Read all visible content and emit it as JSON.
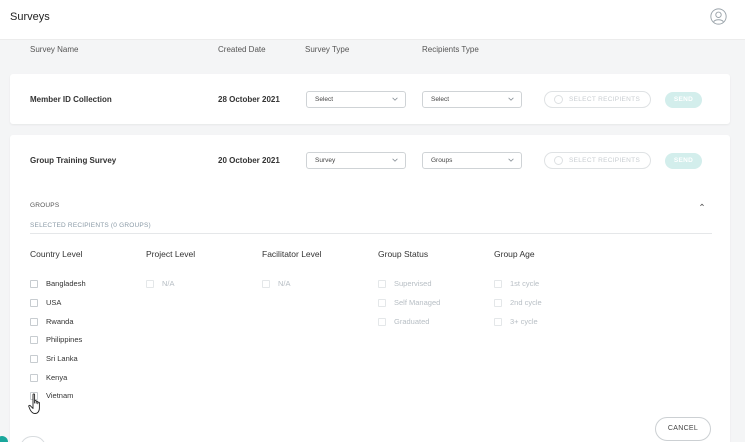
{
  "app": {
    "title": "Surveys",
    "avatar_icon": "user-circle-icon"
  },
  "columns": {
    "name": "Survey Name",
    "created": "Created Date",
    "type": "Survey Type",
    "recipients": "Recipients Type"
  },
  "rows": [
    {
      "name": "Member ID Collection",
      "date": "28 October 2021",
      "survey_type": "Select",
      "recipients_type": "Select",
      "select_recipients_label": "SELECT RECIPIENTS",
      "send_label": "SEND"
    },
    {
      "name": "Group Training Survey",
      "date": "20 October 2021",
      "survey_type": "Survey",
      "recipients_type": "Groups",
      "select_recipients_label": "SELECT RECIPIENTS",
      "send_label": "SEND"
    }
  ],
  "groups_panel": {
    "title": "GROUPS",
    "selected_label": "SELECTED RECIPIENTS (0 GROUPS)",
    "filters": [
      {
        "heading": "Country Level",
        "options": [
          "Bangladesh",
          "USA",
          "Rwanda",
          "Philippines",
          "Sri Lanka",
          "Kenya",
          "Vietnam"
        ],
        "disabled": false
      },
      {
        "heading": "Project Level",
        "options": [
          "N/A"
        ],
        "disabled": true
      },
      {
        "heading": "Facilitator Level",
        "options": [
          "N/A"
        ],
        "disabled": true
      },
      {
        "heading": "Group Status",
        "options": [
          "Supervised",
          "Self Managed",
          "Graduated"
        ],
        "disabled": true
      },
      {
        "heading": "Group Age",
        "options": [
          "1st cycle",
          "2nd cycle",
          "3+ cycle"
        ],
        "disabled": true
      }
    ],
    "cancel_label": "CANCEL"
  },
  "colors": {
    "accent": "#1aa79c",
    "send_disabled": "#d3eeec",
    "background": "#f4f5f6"
  }
}
